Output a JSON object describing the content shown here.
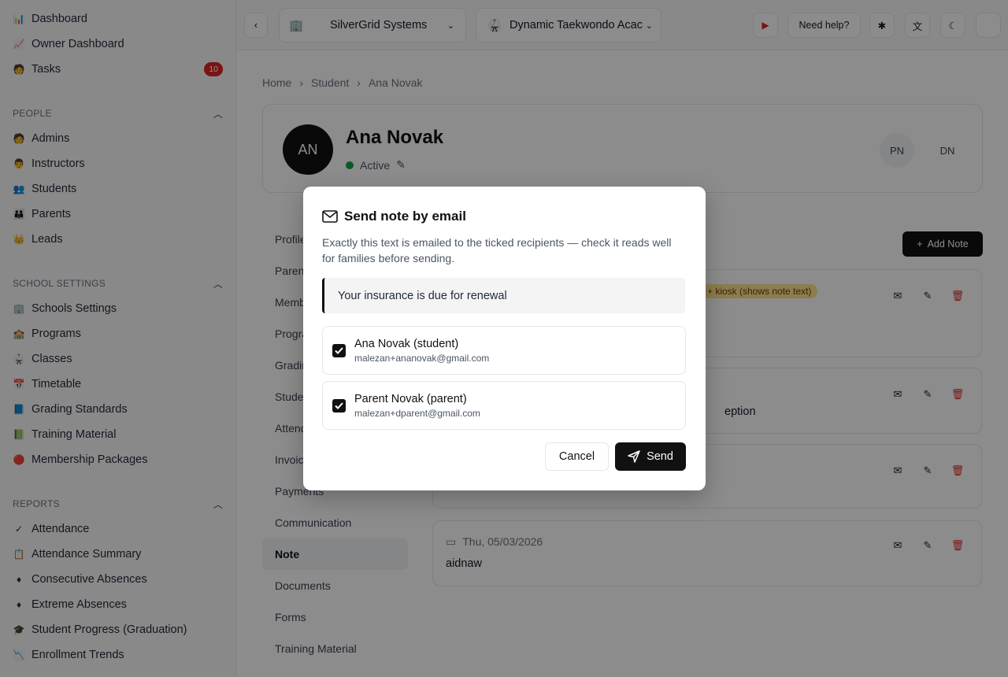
{
  "sidebar": {
    "top_items": [
      {
        "label": "Dashboard",
        "icon": "dashboard-icon"
      },
      {
        "label": "Owner Dashboard",
        "icon": "owner-dashboard-icon"
      },
      {
        "label": "Tasks",
        "icon": "tasks-icon",
        "badge": "10"
      }
    ],
    "sections": [
      {
        "title": "PEOPLE",
        "items": [
          "Admins",
          "Instructors",
          "Students",
          "Parents",
          "Leads"
        ]
      },
      {
        "title": "SCHOOL SETTINGS",
        "items": [
          "Schools Settings",
          "Programs",
          "Classes",
          "Timetable",
          "Grading Standards",
          "Training Material",
          "Membership Packages"
        ]
      },
      {
        "title": "REPORTS",
        "items": [
          "Attendance",
          "Attendance Summary",
          "Consecutive Absences",
          "Extreme Absences",
          "Student Progress (Graduation)",
          "Enrollment Trends"
        ]
      }
    ]
  },
  "topbar": {
    "org": "SilverGrid Systems",
    "school": "Dynamic Taekwondo Acac",
    "help": "Need help?"
  },
  "breadcrumb": [
    "Home",
    "Student",
    "Ana Novak"
  ],
  "profile": {
    "initials": "AN",
    "name": "Ana Novak",
    "status": "Active",
    "mini_avatars": [
      "PN",
      "DN"
    ]
  },
  "tabs": [
    "Profile",
    "Parents",
    "Memberships",
    "Programs",
    "Grading",
    "Student",
    "Attendance",
    "Invoices",
    "Payments",
    "Communication",
    "Note",
    "Documents",
    "Forms",
    "Training Material"
  ],
  "active_tab": "Note",
  "notes": {
    "add_label": "Add Note",
    "tag_text": "+ kiosk (shows note text)",
    "fragment": "eption",
    "last_date": "Thu, 05/03/2026",
    "last_text": "aidnaw"
  },
  "modal": {
    "title": "Send note by email",
    "description": "Exactly this text is emailed to the ticked recipients — check it reads well for families before sending.",
    "note_text": "Your insurance is due for renewal",
    "recipients": [
      {
        "name": "Ana Novak (student)",
        "email": "malezan+ananovak@gmail.com",
        "checked": true
      },
      {
        "name": "Parent Novak (parent)",
        "email": "malezan+dparent@gmail.com",
        "checked": true
      }
    ],
    "cancel_label": "Cancel",
    "send_label": "Send"
  }
}
